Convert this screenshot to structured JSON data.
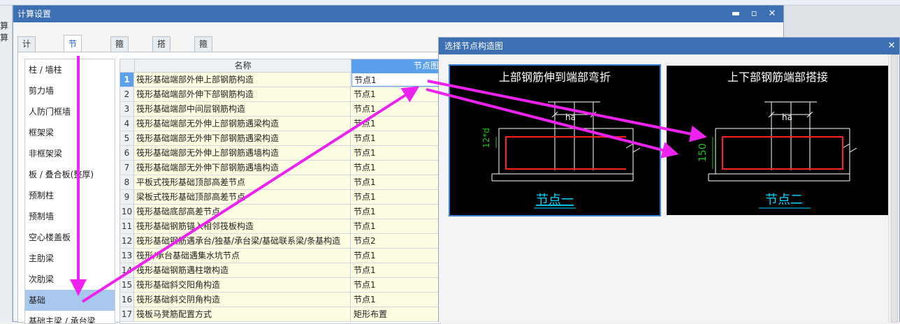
{
  "background": {
    "left_text": "算 算"
  },
  "main_dialog": {
    "title": "计算设置",
    "tabs": [
      "计算规则",
      "节点设置",
      "箍筋设置",
      "搭接设置",
      "箍筋公式"
    ],
    "active_tab": 1
  },
  "categories": {
    "items": [
      "柱 / 墙柱",
      "剪力墙",
      "人防门框墙",
      "框架梁",
      "非框架梁",
      "板 / 叠合板(整厚)",
      "预制柱",
      "预制墙",
      "空心楼盖板",
      "主肋梁",
      "次肋梁",
      "基础",
      "基础主梁 / 承台梁"
    ],
    "selected_index": 11
  },
  "grid": {
    "headers": {
      "name": "名称",
      "node": "节点图"
    },
    "rows": [
      {
        "num": "1",
        "name": "筏形基础端部外伸上部钢筋构造",
        "node": "节点1"
      },
      {
        "num": "2",
        "name": "筏形基础端部外伸下部钢筋构造",
        "node": "节点1"
      },
      {
        "num": "3",
        "name": "筏形基础端部中间层钢筋构造",
        "node": "节点1"
      },
      {
        "num": "4",
        "name": "筏形基础端部无外伸上部钢筋遇梁构造",
        "node": "节点1"
      },
      {
        "num": "5",
        "name": "筏形基础端部无外伸下部钢筋遇梁构造",
        "node": "节点1"
      },
      {
        "num": "6",
        "name": "筏形基础端部无外伸上部钢筋遇墙构造",
        "node": "节点1"
      },
      {
        "num": "7",
        "name": "筏形基础端部无外伸下部钢筋遇墙构造",
        "node": "节点1"
      },
      {
        "num": "8",
        "name": "平板式筏形基础顶部高差节点",
        "node": "节点1"
      },
      {
        "num": "9",
        "name": "梁板式筏形基础顶部高差节点",
        "node": "节点1"
      },
      {
        "num": "10",
        "name": "筏形基础底部高差节点",
        "node": "节点1"
      },
      {
        "num": "11",
        "name": "筏形基础钢筋锚入相邻筏板构造",
        "node": "节点1"
      },
      {
        "num": "12",
        "name": "筏形基础钢筋遇承台/独基/承台梁/基础联系梁/条基构造",
        "node": "节点2"
      },
      {
        "num": "13",
        "name": "筏形/承台基础遇集水坑节点",
        "node": "节点1"
      },
      {
        "num": "14",
        "name": "筏形基础钢筋遇柱墩构造",
        "node": "节点1"
      },
      {
        "num": "15",
        "name": "筏形基础斜交阳角构造",
        "node": "节点1"
      },
      {
        "num": "16",
        "name": "筏形基础斜交阴角构造",
        "node": "节点1"
      },
      {
        "num": "17",
        "name": "筏板马凳筋配置方式",
        "node": "矩形布置"
      }
    ],
    "selected_row": 0
  },
  "popup": {
    "title": "选择节点构造图",
    "options": [
      {
        "heading": "上部钢筋伸到端部弯折",
        "dim_label": "12*d",
        "ha_label": "ha",
        "caption": "节点一"
      },
      {
        "heading": "上下部钢筋端部搭接",
        "dim_label": "150",
        "ha_label": "ha",
        "caption": "节点二"
      }
    ],
    "selected_option": 0
  },
  "colors": {
    "title_bar": "#3d6fb3",
    "selection": "#5ba0ea",
    "rebar": "#ff2020",
    "dimension": "#22c322",
    "caption": "#00d4ff",
    "annotation_arrow": "#ee22ee"
  }
}
